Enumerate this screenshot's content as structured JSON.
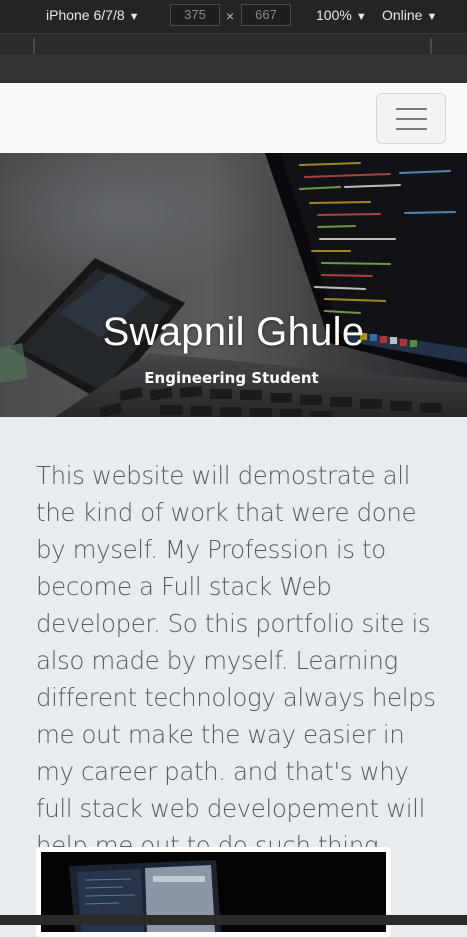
{
  "devtools": {
    "device": "iPhone 6/7/8",
    "width": "375",
    "height": "667",
    "times": "×",
    "zoom": "100%",
    "network": "Online",
    "caret": "▼"
  },
  "hero": {
    "title": "Swapnil Ghule",
    "subtitle": "Engineering Student"
  },
  "intro": {
    "text": "This website will demostrate all the kind of work that were done by myself. My Profession is to become a Full stack Web developer. So this portfolio site is also made by myself. Learning different technology always helps me out make the way easier in my career path. and that's why full stack web developement will help me out to do such thing."
  },
  "colors": {
    "page_bg": "#e9ecef",
    "navbar_bg": "#f8f9fa",
    "text": "#555b62",
    "devtools_bg": "#242424"
  },
  "icons": {
    "menu": "hamburger-icon"
  }
}
